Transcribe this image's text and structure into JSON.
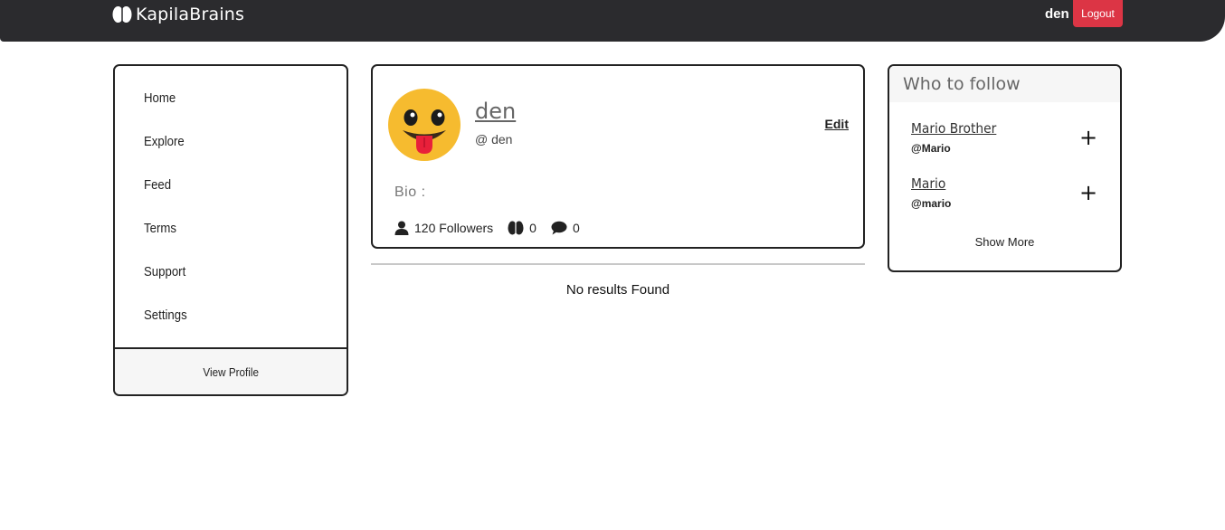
{
  "navbar": {
    "brand": "KapilaBrains",
    "username": "den",
    "logout_label": "Logout",
    "logout_color": "#dc3545",
    "background": "#2b2b2e"
  },
  "sidebar": {
    "items": [
      {
        "label": "Home"
      },
      {
        "label": "Explore"
      },
      {
        "label": "Feed"
      },
      {
        "label": "Terms"
      },
      {
        "label": "Support"
      },
      {
        "label": "Settings"
      }
    ],
    "footer_label": "View Profile"
  },
  "profile": {
    "avatar_icon": "tongue-out-emoji-icon",
    "name": "den",
    "handle": "@ den",
    "edit_label": "Edit",
    "bio_label": "Bio :",
    "followers": "120 Followers",
    "brains_count": "0",
    "comments_count": "0"
  },
  "feed": {
    "empty_message": "No results Found"
  },
  "who_to_follow": {
    "title": "Who to follow",
    "users": [
      {
        "name": "Mario Brother",
        "handle": "@Mario"
      },
      {
        "name": "Mario",
        "handle": "@mario"
      }
    ],
    "follow_icon": "+",
    "show_more_label": "Show More"
  }
}
